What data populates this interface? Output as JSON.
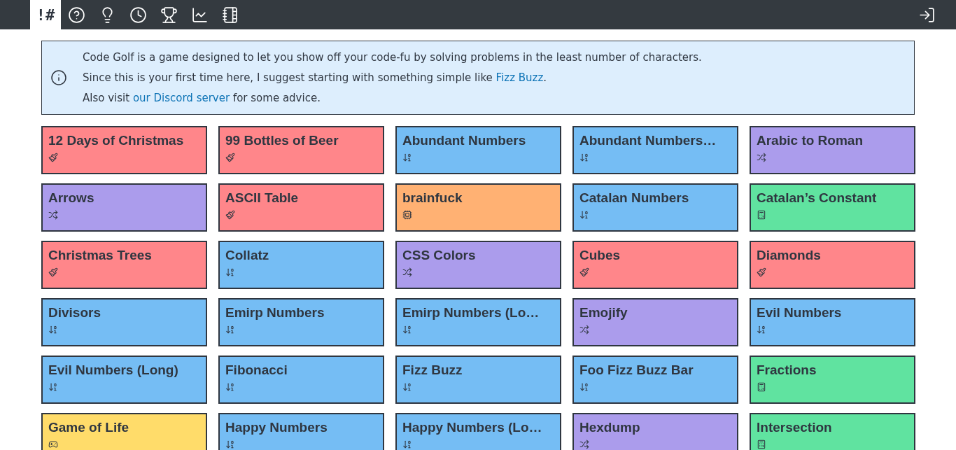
{
  "nav": {
    "logo": "!#",
    "tabs": [
      {
        "kind": "logo",
        "selected": true
      },
      {
        "kind": "help",
        "selected": false
      },
      {
        "kind": "ideas",
        "selected": false
      },
      {
        "kind": "recent",
        "selected": false
      },
      {
        "kind": "trophies",
        "selected": false
      },
      {
        "kind": "stats",
        "selected": false
      },
      {
        "kind": "wiki",
        "selected": false
      }
    ]
  },
  "info": {
    "lines": [
      [
        {
          "text": "Code Golf is a game designed to let you show off your code-fu by solving problems in the least number of characters."
        }
      ],
      [
        {
          "text": "Since this is your first time here, I suggest starting with something simple like "
        },
        {
          "link": "Fizz Buzz"
        },
        {
          "text": "."
        }
      ],
      [
        {
          "text": "Also visit "
        },
        {
          "link": "our Discord server"
        },
        {
          "text": " for some advice."
        }
      ]
    ]
  },
  "holes": [
    {
      "name": "12 Days of Christmas",
      "kind": "art"
    },
    {
      "name": "99 Bottles of Beer",
      "kind": "art"
    },
    {
      "name": "Abundant Numbers",
      "kind": "sequence"
    },
    {
      "name": "Abundant Numbers…",
      "kind": "sequence"
    },
    {
      "name": "Arabic to Roman",
      "kind": "transform"
    },
    {
      "name": "Arrows",
      "kind": "transform"
    },
    {
      "name": "ASCII Table",
      "kind": "art"
    },
    {
      "name": "brainfuck",
      "kind": "computing"
    },
    {
      "name": "Catalan Numbers",
      "kind": "sequence"
    },
    {
      "name": "Catalan’s Constant",
      "kind": "math"
    },
    {
      "name": "Christmas Trees",
      "kind": "art"
    },
    {
      "name": "Collatz",
      "kind": "sequence"
    },
    {
      "name": "CSS Colors",
      "kind": "transform"
    },
    {
      "name": "Cubes",
      "kind": "art"
    },
    {
      "name": "Diamonds",
      "kind": "art"
    },
    {
      "name": "Divisors",
      "kind": "sequence"
    },
    {
      "name": "Emirp Numbers",
      "kind": "sequence"
    },
    {
      "name": "Emirp Numbers (Lo…",
      "kind": "sequence"
    },
    {
      "name": "Emojify",
      "kind": "transform"
    },
    {
      "name": "Evil Numbers",
      "kind": "sequence"
    },
    {
      "name": "Evil Numbers (Long)",
      "kind": "sequence"
    },
    {
      "name": "Fibonacci",
      "kind": "sequence"
    },
    {
      "name": "Fizz Buzz",
      "kind": "sequence"
    },
    {
      "name": "Foo Fizz Buzz Bar",
      "kind": "sequence"
    },
    {
      "name": "Fractions",
      "kind": "math"
    },
    {
      "name": "Game of Life",
      "kind": "gaming"
    },
    {
      "name": "Happy Numbers",
      "kind": "sequence"
    },
    {
      "name": "Happy Numbers (Lo…",
      "kind": "sequence"
    },
    {
      "name": "Hexdump",
      "kind": "transform"
    },
    {
      "name": "Intersection",
      "kind": "math"
    }
  ]
}
